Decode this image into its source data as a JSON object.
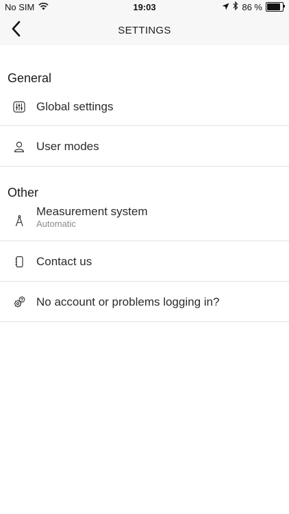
{
  "status_bar": {
    "carrier": "No SIM",
    "time": "19:03",
    "battery_text": "86 %",
    "battery_level": 0.86,
    "icons": [
      "wifi-icon",
      "location-arrow-icon",
      "bluetooth-icon",
      "battery-icon"
    ]
  },
  "nav": {
    "title": "SETTINGS",
    "back_icon": "chevron-left-icon"
  },
  "sections": {
    "general": {
      "header": "General",
      "items": [
        {
          "label": "Global settings",
          "icon": "sliders-icon"
        },
        {
          "label": "User modes",
          "icon": "user-icon"
        }
      ]
    },
    "other": {
      "header": "Other",
      "items": [
        {
          "label": "Measurement system",
          "sublabel": "Automatic",
          "icon": "compass-drafting-icon"
        },
        {
          "label": "Contact us",
          "icon": "address-book-icon"
        },
        {
          "label": "No account or problems logging in?",
          "icon": "gear-question-icon"
        }
      ]
    }
  },
  "colors": {
    "bar_background": "#f7f7f7",
    "separator": "#e3e3e3",
    "sublabel": "#8a8a8a"
  }
}
